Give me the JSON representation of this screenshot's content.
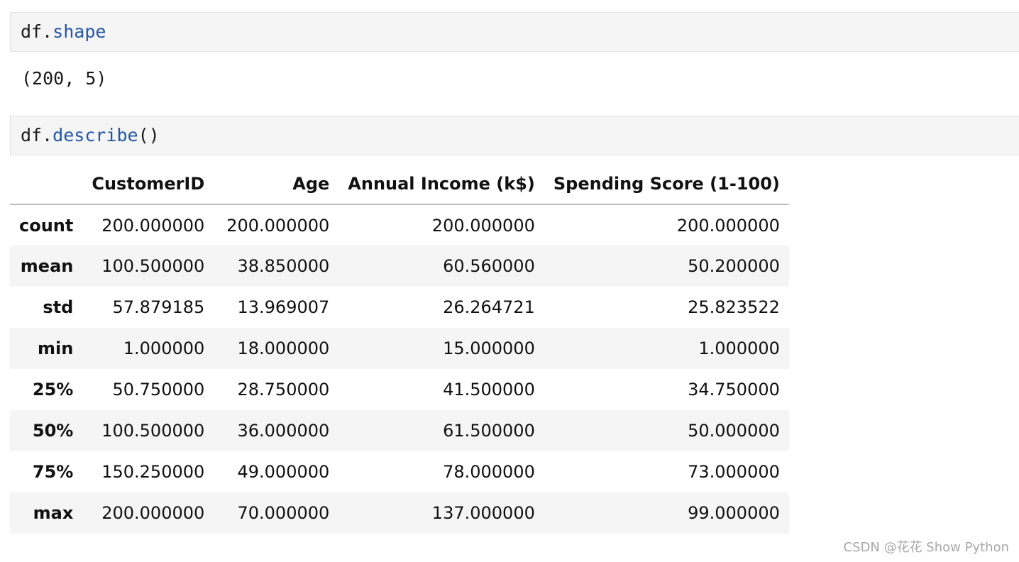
{
  "cells": [
    {
      "object": "df",
      "dot": ".",
      "attribute": "shape",
      "call": "",
      "output": "(200, 5)"
    },
    {
      "object": "df",
      "dot": ".",
      "attribute": "describe",
      "call": "()"
    }
  ],
  "table": {
    "columns": [
      "CustomerID",
      "Age",
      "Annual Income (k$)",
      "Spending Score (1-100)"
    ],
    "rows": [
      {
        "label": "count",
        "values": [
          "200.000000",
          "200.000000",
          "200.000000",
          "200.000000"
        ]
      },
      {
        "label": "mean",
        "values": [
          "100.500000",
          "38.850000",
          "60.560000",
          "50.200000"
        ]
      },
      {
        "label": "std",
        "values": [
          "57.879185",
          "13.969007",
          "26.264721",
          "25.823522"
        ]
      },
      {
        "label": "min",
        "values": [
          "1.000000",
          "18.000000",
          "15.000000",
          "1.000000"
        ]
      },
      {
        "label": "25%",
        "values": [
          "50.750000",
          "28.750000",
          "41.500000",
          "34.750000"
        ]
      },
      {
        "label": "50%",
        "values": [
          "100.500000",
          "36.000000",
          "61.500000",
          "50.000000"
        ]
      },
      {
        "label": "75%",
        "values": [
          "150.250000",
          "49.000000",
          "78.000000",
          "73.000000"
        ]
      },
      {
        "label": "max",
        "values": [
          "200.000000",
          "70.000000",
          "137.000000",
          "99.000000"
        ]
      }
    ]
  },
  "watermark": "CSDN @花花 Show Python",
  "colors": {
    "code_attribute": "#2257a6",
    "cell_background": "#f5f5f5"
  }
}
